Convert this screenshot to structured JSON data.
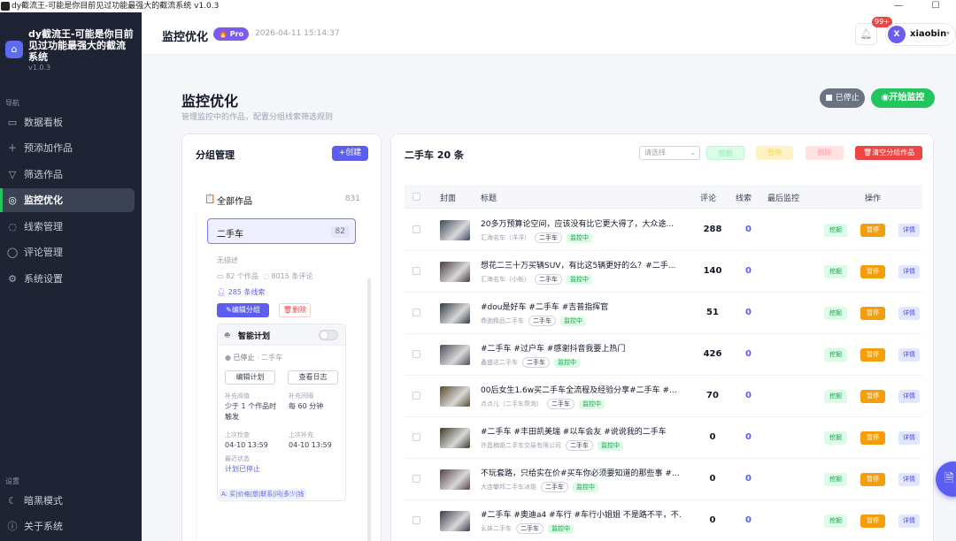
{
  "window": {
    "title": "dy截流王-可能是你目前见过功能最强大的截流系统 v1.0.3"
  },
  "sidebar": {
    "app_title": "dy截流王-可能是你目前见过功能最强大的截流系统",
    "version": "v1.0.3",
    "nav_label": "导航",
    "items": [
      {
        "label": "数据看板",
        "icon": "dashboard-icon"
      },
      {
        "label": "预添加作品",
        "icon": "plus-icon"
      },
      {
        "label": "筛选作品",
        "icon": "filter-icon"
      },
      {
        "label": "监控优化",
        "icon": "monitor-icon",
        "active": true
      },
      {
        "label": "线索管理",
        "icon": "clue-icon"
      },
      {
        "label": "评论管理",
        "icon": "comment-icon"
      },
      {
        "label": "系统设置",
        "icon": "gear-icon"
      }
    ],
    "settings_label": "设置",
    "bottom_items": [
      {
        "label": "暗黑模式",
        "icon": "moon-icon"
      },
      {
        "label": "关于系统",
        "icon": "info-icon"
      }
    ]
  },
  "topbar": {
    "title": "监控优化",
    "badge": "Pro",
    "time": "2026-04-11 15:14:37",
    "notif_count": "99+",
    "user_initial": "X",
    "username": "xiaobin"
  },
  "page": {
    "title": "监控优化",
    "subtitle": "管理监控中的作品，配置分组线索筛选规则",
    "stop_btn": "已停止",
    "start_btn": "开始监控"
  },
  "groups": {
    "title": "分组管理",
    "create_btn": "+创建",
    "all_label": "全部作品",
    "all_count": "831",
    "selected": {
      "name": "二手车",
      "count": "82",
      "desc": "无描述",
      "works": "82 个作品",
      "comments": "8015 条评论",
      "clues": "285 条线索",
      "edit_btn": "编辑分组",
      "delete_btn": "删除"
    },
    "smart_plan": {
      "title": "智能计划",
      "state": "已停止",
      "state_group": "· 二手车",
      "edit_btn": "编辑计划",
      "log_btn": "查看日志",
      "threshold_label": "补充阈值",
      "threshold_value": "少于 1 个作品时触发",
      "interval_label": "补充间隔",
      "interval_value": "每 60 分钟",
      "last_check_label": "上次检查",
      "last_check": "04-10 13:59",
      "last_supp_label": "上次补充",
      "last_supp": "04-10 13:59",
      "recent_label": "最近状态",
      "recent_value": "计划已停止",
      "keywords": "A: 买|价格|想|联系|问|多少|钱"
    }
  },
  "works": {
    "title": "二手车 20 条",
    "select_placeholder": "请选择",
    "btns": [
      "挖掘",
      "暂停",
      "删除",
      "清空分组作品"
    ],
    "columns": [
      "封面",
      "标题",
      "评论",
      "线索",
      "最后监控",
      "操作"
    ],
    "action_labels": [
      "挖掘",
      "暂停",
      "详情"
    ],
    "rows": [
      {
        "title": "20多万预算论空间，应该没有比它更大得了，大众途...",
        "author": "汇海名车（洋洋）",
        "tag": "二手车",
        "status": "监控中",
        "comments": "288",
        "clues": "0"
      },
      {
        "title": "想花二三十万买辆SUV，有比这5辆更好的么？#二手...",
        "author": "汇海名车（小帐）",
        "tag": "二手车",
        "status": "监控中",
        "comments": "140",
        "clues": "0"
      },
      {
        "title": "#dou是好车 #二手车 #吉普指挥官",
        "author": "鼎驰精品二手车",
        "tag": "二手车",
        "status": "监控中",
        "comments": "51",
        "clues": "0"
      },
      {
        "title": "#二手车 #过户车 #感谢抖音我要上热门",
        "author": "鑫盛达二手车",
        "tag": "二手车",
        "status": "监控中",
        "comments": "426",
        "clues": "0"
      },
      {
        "title": "00后女生1.6w买二手车全流程及经验分享#二手车 #...",
        "author": "点点儿（二手车帮淘）",
        "tag": "二手车",
        "status": "监控中",
        "comments": "70",
        "clues": "0"
      },
      {
        "title": "#二手车 #丰田凯美瑞 #以车会友 #说说我的二手车",
        "author": "许昌楠姐二手车交易有限公司",
        "tag": "二手车",
        "status": "监控中",
        "comments": "0",
        "clues": "0"
      },
      {
        "title": "不玩套路，只给实在价#买车你必须要知道的那些事 #...",
        "author": "大连攀邦二手车冰姐",
        "tag": "二手车",
        "status": "监控中",
        "comments": "0",
        "clues": "0"
      },
      {
        "title": "#二手车 #奥迪a4 #车行 #车行小姐姐 不是路不平，不...",
        "author": "幺妹二手车",
        "tag": "二手车",
        "status": "监控中",
        "comments": "0",
        "clues": "0"
      }
    ]
  },
  "colors": {
    "accent": "#5b5ef0",
    "success": "#22c55e",
    "warning": "#f59e0b",
    "danger": "#ef4444"
  }
}
